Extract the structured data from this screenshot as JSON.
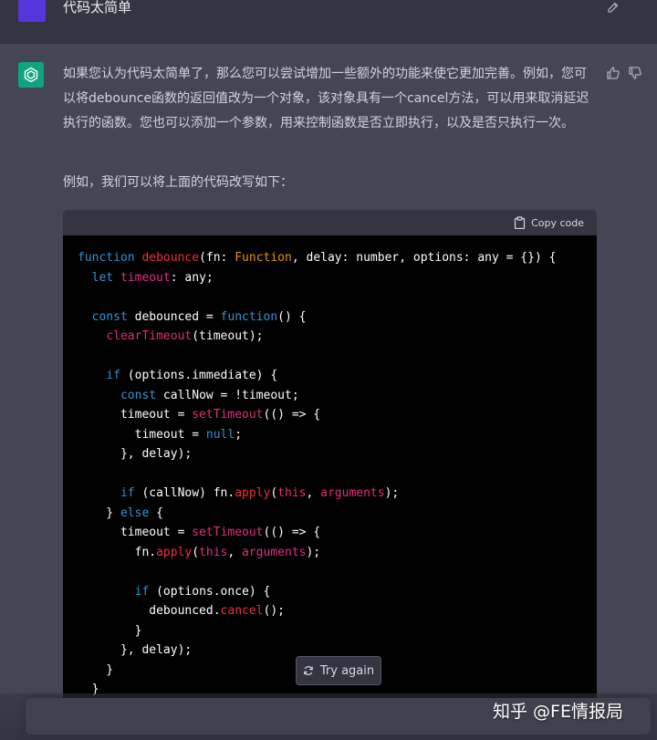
{
  "user_message": {
    "text": "代码太简单"
  },
  "assistant": {
    "paragraph1": "如果您认为代码太简单了，那么您可以尝试增加一些额外的功能来使它更加完善。例如，您可以将debounce函数的返回值改为一个对象，该对象具有一个cancel方法，可以用来取消延迟执行的函数。您也可以添加一个参数，用来控制函数是否立即执行，以及是否只执行一次。",
    "paragraph2": "例如，我们可以将上面的代码改写如下："
  },
  "code_block": {
    "copy_label": "Copy code",
    "language": "typescript"
  },
  "try_again": {
    "label": "Try again"
  },
  "watermark": {
    "text": "知乎 @FE情报局"
  },
  "colors": {
    "user_avatar": "#5436da",
    "assistant_avatar": "#10a37f",
    "keyword": "#2e95d3",
    "function_name": "#f22c3d",
    "builtin": "#df3079",
    "type": "#e9950c"
  },
  "icons": [
    "edit-icon",
    "openai-logo-icon",
    "thumbs-up-icon",
    "thumbs-down-icon",
    "clipboard-icon",
    "refresh-icon"
  ]
}
